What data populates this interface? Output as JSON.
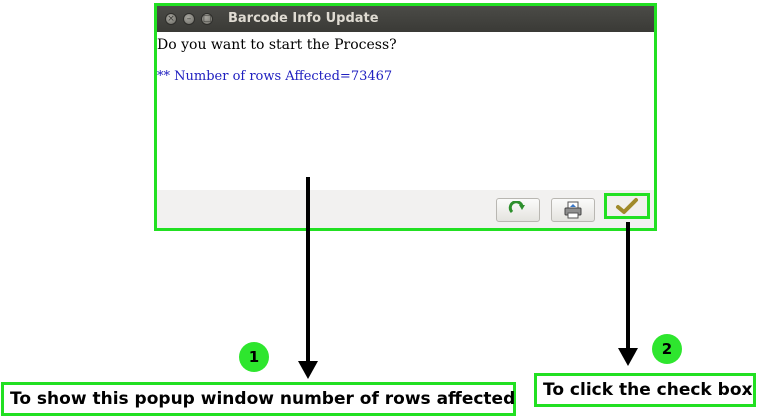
{
  "dialog": {
    "title": "Barcode Info Update",
    "prompt": "Do you want to start the Process?",
    "rows_info": "** Number of rows Affected=73467",
    "buttons": {
      "refresh_icon": "refresh-icon",
      "print_icon": "print-icon",
      "ok_icon": "checkmark-icon"
    }
  },
  "annotations": {
    "badge1": "1",
    "badge2": "2",
    "callout1": "To show this popup window number of rows affected",
    "callout2": "To click the check box",
    "highlight_color": "#22e022"
  }
}
